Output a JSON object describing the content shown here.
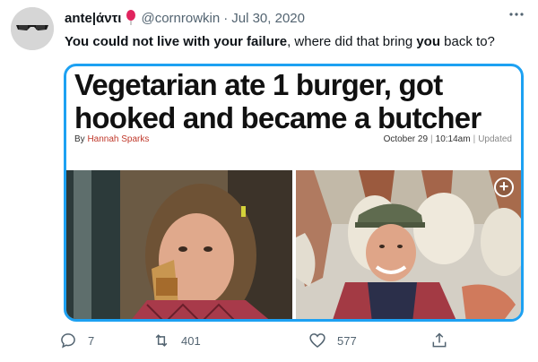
{
  "user": {
    "name": "ante|άντι",
    "handle": "@cornrowkin",
    "separator": "·",
    "date": "Jul 30, 2020"
  },
  "tweet": {
    "text_part1": "You could not live with your failure",
    "text_part2": ", where did that bring ",
    "text_part3": "you",
    "text_part4": " back to?"
  },
  "article": {
    "headline": "Vegetarian ate 1 burger, got hooked and became a butcher",
    "byline_prefix": "By ",
    "author": "Hannah Sparks",
    "date": "October 29",
    "time": "10:14am",
    "updated": "Updated",
    "sep": "|"
  },
  "actions": {
    "replies": "7",
    "retweets": "401",
    "likes": "577"
  },
  "icons": {
    "avatar": "avatar-icon",
    "emoji": "balloon-icon",
    "more": "more-icon",
    "reply": "reply-icon",
    "retweet": "retweet-icon",
    "like": "heart-icon",
    "share": "share-icon",
    "add_media": "plus-circle-icon"
  },
  "colors": {
    "accent": "#1da1f2",
    "muted": "#536471",
    "author": "#c0392b"
  }
}
